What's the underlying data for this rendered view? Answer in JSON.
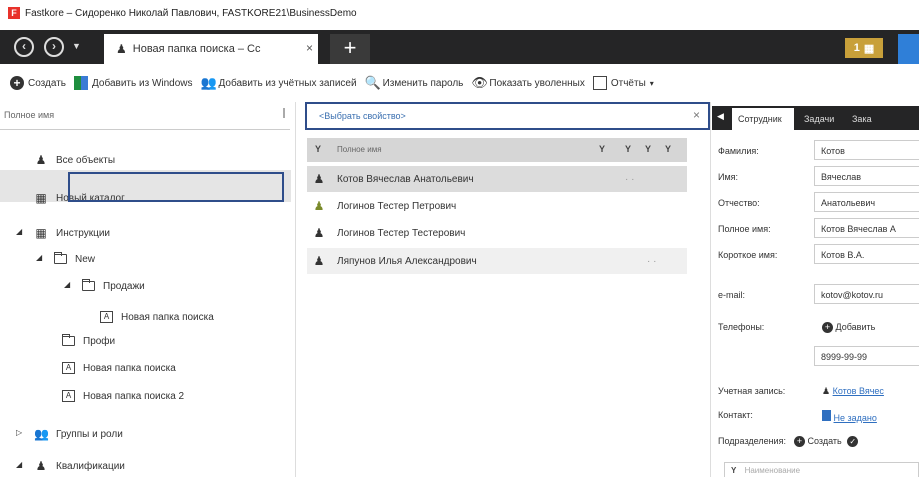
{
  "window": {
    "title": "Fastkore – Сидоренко Николай Павлович, FASTKORE21\\BusinessDemo",
    "logo_text": "F"
  },
  "tabbar": {
    "active_tab_label": "Новая папка поиска – Сс",
    "new_tab": "+",
    "counter": "1",
    "close": "×"
  },
  "toolbar": {
    "create": "Создать",
    "add_from_windows": "Добавить из Windows",
    "add_from_accounts": "Добавить из учётных записей",
    "change_password": "Изменить пароль",
    "show_dismissed": "Показать уволенных",
    "reports": "Отчёты"
  },
  "left_panel": {
    "header": "Полное имя",
    "items": [
      {
        "label": "Все объекты",
        "icon": "person-icon"
      },
      {
        "label": "Новый каталог",
        "icon": "catalog-icon"
      },
      {
        "label": "Инструкции",
        "icon": "catalog-icon"
      },
      {
        "label": "New",
        "icon": "folder-icon"
      },
      {
        "label": "Продажи",
        "icon": "folder-icon"
      },
      {
        "label": "Новая папка поиска",
        "icon": "search-folder-icon"
      },
      {
        "label": "Профи",
        "icon": "folder-icon"
      },
      {
        "label": "Новая папка поиска",
        "icon": "search-folder-icon"
      },
      {
        "label": "Новая папка поиска 2",
        "icon": "search-folder-icon"
      },
      {
        "label": "Группы и роли",
        "icon": "group-icon"
      },
      {
        "label": "Квалификации",
        "icon": "qualification-icon"
      }
    ]
  },
  "center_panel": {
    "property_selector": "<Выбрать свойство>",
    "close": "×",
    "grid_header": "Полное имя",
    "rows": [
      "Котов Вячеслав Анатольевич",
      "Логинов Тестер Петрович",
      "Логинов Тестер Тестерович",
      "Ляпунов Илья Александрович"
    ]
  },
  "right_panel": {
    "tabs": [
      "Сотрудник",
      "Задачи",
      "Зака"
    ],
    "fields": {
      "lastname_label": "Фамилия:",
      "lastname": "Котов",
      "firstname_label": "Имя:",
      "firstname": "Вячеслав",
      "patronymic_label": "Отчество:",
      "patronymic": "Анатольевич",
      "fullname_label": "Полное имя:",
      "fullname": "Котов Вячеслав А",
      "shortname_label": "Короткое имя:",
      "shortname": "Котов В.А.",
      "email_label": "e-mail:",
      "email": "kotov@kotov.ru",
      "phones_label": "Телефоны:",
      "add_label": "Добавить",
      "phone": "8999-99-99",
      "account_label": "Учетная запись:",
      "account": "Котов Вячес",
      "contact_label": "Контакт:",
      "contact": "Не задано",
      "divisions_label": "Подразделения:",
      "divisions_create": "Создать",
      "bottom_header": "Наименование"
    }
  }
}
